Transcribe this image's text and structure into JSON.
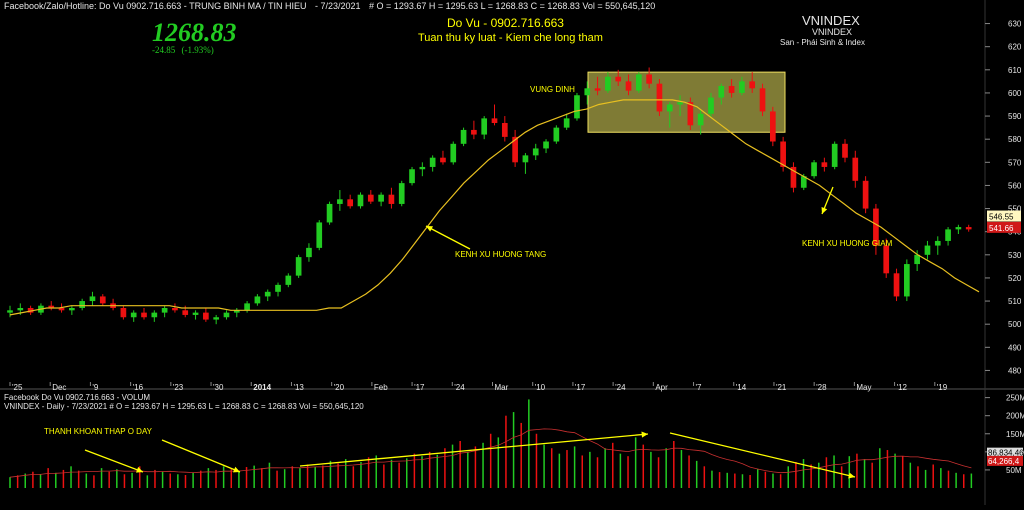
{
  "header": {
    "title_line": "Facebook/Zalo/Hotline: Do Vu 0902.716.663 - TRUNG BINH MA / TIN HIEU",
    "date": "- 7/23/2021",
    "ohlc": "#   O = 1293.67  H = 1295.63  L = 1268.83  C = 1268.83  Vol = 550,645,120"
  },
  "price_box": {
    "last": "1268.83",
    "change": "-24.85",
    "change_pct": "(-1.93%)"
  },
  "center_title": {
    "name": "Do Vu - 0902.716.663",
    "motto": "Tuan thu ky luat - Kiem che long tham"
  },
  "symbol_box": {
    "big": "VNINDEX",
    "small": "VNINDEX",
    "sub": "San - Phái Sinh & Index"
  },
  "annotations": {
    "vung_dinh": "VUNG DINH",
    "kenh_tang": "KENH XU HUONG TANG",
    "kenh_giam": "KENH XU HUONG GIAM",
    "thanh_khoan": "THANH KHOAN THAP O DAY"
  },
  "price_axis": {
    "ticks": [
      "630",
      "620",
      "610",
      "600",
      "590",
      "580",
      "570",
      "560",
      "550",
      "540",
      "530",
      "520",
      "510",
      "500",
      "490",
      "480"
    ],
    "ma_label": "546.55",
    "close_label": "541.66"
  },
  "date_axis": {
    "labels": [
      "'25",
      "Dec",
      "'9",
      "'16",
      "'23",
      "'30",
      "2014",
      "'13",
      "'20",
      "Feb",
      "'17",
      "'24",
      "Mar",
      "'10",
      "'17",
      "'24",
      "Apr",
      "'7",
      "'14",
      "'21",
      "'28",
      "May",
      "'12",
      "'19"
    ]
  },
  "volume_panel": {
    "title1": "Facebook Do Vu 0902.716.663 - VOLUM",
    "title2": "VNINDEX - Daily  - 7/23/2021  # O = 1293.67  H = 1295.63  L = 1268.83  C = 1268.83  Vol = 550,645,120",
    "ticks": [
      "250M",
      "200M",
      "150M",
      "100M",
      "50M"
    ],
    "label_ma": "86,834,46",
    "label_last": "64,266,4"
  },
  "colors": {
    "up": "#22cc22",
    "down": "#ee1111",
    "ma": "#e8c020",
    "zone": "#e8e060",
    "bg": "#000000",
    "annot": "#ffff00"
  },
  "chart_data": [
    {
      "type": "candlestick",
      "title": "VNINDEX",
      "ylim": [
        475,
        635
      ],
      "series": [
        {
          "name": "MA",
          "values": [
            504,
            505,
            506,
            507,
            507,
            508,
            508,
            508,
            508,
            508,
            508,
            508,
            508,
            508,
            507,
            507,
            507,
            507,
            506,
            506,
            506,
            506,
            506,
            506,
            506,
            506,
            507,
            507,
            510,
            513,
            517,
            522,
            528,
            535,
            542,
            549,
            555,
            561,
            566,
            571,
            575,
            579,
            583,
            586,
            588,
            590,
            592,
            593,
            595,
            596,
            597,
            597,
            597,
            597,
            597,
            596,
            594,
            590,
            586,
            582,
            578,
            575,
            572,
            569,
            566,
            563,
            560,
            556,
            552,
            548,
            545,
            542,
            538,
            534,
            530,
            527,
            524,
            520,
            517,
            514
          ]
        }
      ],
      "ohlc": [
        [
          505,
          508,
          503,
          506
        ],
        [
          506,
          509,
          504,
          507
        ],
        [
          507,
          508,
          504,
          505
        ],
        [
          505,
          509,
          504,
          508
        ],
        [
          508,
          510,
          506,
          507
        ],
        [
          507,
          509,
          505,
          506
        ],
        [
          506,
          508,
          504,
          507
        ],
        [
          507,
          511,
          506,
          510
        ],
        [
          510,
          514,
          508,
          512
        ],
        [
          512,
          513,
          508,
          509
        ],
        [
          509,
          511,
          506,
          507
        ],
        [
          507,
          508,
          502,
          503
        ],
        [
          503,
          506,
          501,
          505
        ],
        [
          505,
          507,
          502,
          503
        ],
        [
          503,
          506,
          501,
          505
        ],
        [
          505,
          508,
          503,
          507
        ],
        [
          507,
          509,
          505,
          506
        ],
        [
          506,
          508,
          503,
          504
        ],
        [
          504,
          506,
          502,
          505
        ],
        [
          505,
          507,
          501,
          502
        ],
        [
          502,
          504,
          500,
          503
        ],
        [
          503,
          506,
          502,
          505
        ],
        [
          505,
          507,
          503,
          506
        ],
        [
          506,
          510,
          505,
          509
        ],
        [
          509,
          513,
          508,
          512
        ],
        [
          512,
          515,
          510,
          514
        ],
        [
          514,
          518,
          512,
          517
        ],
        [
          517,
          522,
          516,
          521
        ],
        [
          521,
          530,
          520,
          529
        ],
        [
          529,
          535,
          527,
          533
        ],
        [
          533,
          545,
          532,
          544
        ],
        [
          544,
          553,
          543,
          552
        ],
        [
          552,
          558,
          549,
          554
        ],
        [
          554,
          556,
          550,
          551
        ],
        [
          551,
          557,
          550,
          556
        ],
        [
          556,
          558,
          552,
          553
        ],
        [
          553,
          557,
          551,
          556
        ],
        [
          556,
          559,
          550,
          552
        ],
        [
          552,
          562,
          551,
          561
        ],
        [
          561,
          568,
          560,
          567
        ],
        [
          567,
          570,
          564,
          568
        ],
        [
          568,
          573,
          566,
          572
        ],
        [
          572,
          575,
          569,
          570
        ],
        [
          570,
          579,
          569,
          578
        ],
        [
          578,
          585,
          577,
          584
        ],
        [
          584,
          588,
          580,
          582
        ],
        [
          582,
          590,
          580,
          589
        ],
        [
          589,
          595,
          586,
          587
        ],
        [
          587,
          590,
          579,
          581
        ],
        [
          581,
          584,
          568,
          570
        ],
        [
          570,
          574,
          565,
          573
        ],
        [
          573,
          578,
          571,
          576
        ],
        [
          576,
          580,
          574,
          579
        ],
        [
          579,
          586,
          578,
          585
        ],
        [
          585,
          591,
          584,
          589
        ],
        [
          589,
          600,
          588,
          599
        ],
        [
          599,
          605,
          595,
          602
        ],
        [
          602,
          607,
          599,
          601
        ],
        [
          601,
          609,
          600,
          607
        ],
        [
          607,
          610,
          603,
          605
        ],
        [
          605,
          608,
          599,
          601
        ],
        [
          601,
          609,
          600,
          608
        ],
        [
          608,
          611,
          602,
          604
        ],
        [
          604,
          606,
          590,
          592
        ],
        [
          592,
          596,
          585,
          595
        ],
        [
          595,
          599,
          590,
          596
        ],
        [
          596,
          598,
          584,
          586
        ],
        [
          586,
          593,
          582,
          591
        ],
        [
          591,
          600,
          589,
          598
        ],
        [
          598,
          604,
          595,
          603
        ],
        [
          603,
          606,
          598,
          600
        ],
        [
          600,
          607,
          599,
          605
        ],
        [
          605,
          609,
          600,
          602
        ],
        [
          602,
          604,
          590,
          592
        ],
        [
          592,
          594,
          577,
          579
        ],
        [
          579,
          581,
          566,
          568
        ],
        [
          568,
          570,
          557,
          559
        ],
        [
          559,
          565,
          558,
          564
        ],
        [
          564,
          571,
          563,
          570
        ],
        [
          570,
          572,
          566,
          568
        ],
        [
          568,
          579,
          567,
          578
        ],
        [
          578,
          580,
          570,
          572
        ],
        [
          572,
          575,
          559,
          562
        ],
        [
          562,
          564,
          548,
          550
        ],
        [
          550,
          552,
          530,
          534
        ],
        [
          534,
          537,
          520,
          522
        ],
        [
          522,
          524,
          510,
          512
        ],
        [
          512,
          528,
          510,
          526
        ],
        [
          526,
          532,
          523,
          530
        ],
        [
          530,
          536,
          528,
          534
        ],
        [
          534,
          538,
          530,
          536
        ],
        [
          536,
          542,
          534,
          541
        ],
        [
          541,
          543,
          539,
          542
        ],
        [
          542,
          543,
          540,
          541
        ]
      ]
    },
    {
      "type": "bar",
      "title": "VOLUM",
      "ylim": [
        0,
        260
      ],
      "values": [
        30,
        35,
        40,
        45,
        38,
        55,
        42,
        50,
        60,
        48,
        40,
        35,
        55,
        45,
        52,
        38,
        42,
        60,
        35,
        50,
        45,
        40,
        38,
        36,
        42,
        48,
        55,
        50,
        60,
        52,
        48,
        58,
        62,
        55,
        70,
        48,
        52,
        60,
        55,
        65,
        58,
        62,
        75,
        68,
        80,
        60,
        72,
        85,
        90,
        65,
        78,
        70,
        82,
        95,
        88,
        100,
        92,
        110,
        120,
        130,
        100,
        115,
        125,
        150,
        140,
        200,
        210,
        180,
        245,
        150,
        120,
        110,
        95,
        105,
        115,
        90,
        100,
        85,
        110,
        125,
        95,
        88,
        140,
        120,
        100,
        85,
        110,
        130,
        105,
        90,
        75,
        60,
        48,
        44,
        42,
        40,
        38,
        36,
        52,
        45,
        40,
        38,
        60,
        72,
        80,
        65,
        70,
        85,
        90,
        60,
        88,
        95,
        80,
        70,
        110,
        105,
        95,
        88,
        70,
        60,
        50,
        65,
        55,
        48,
        42,
        38,
        40
      ]
    }
  ]
}
